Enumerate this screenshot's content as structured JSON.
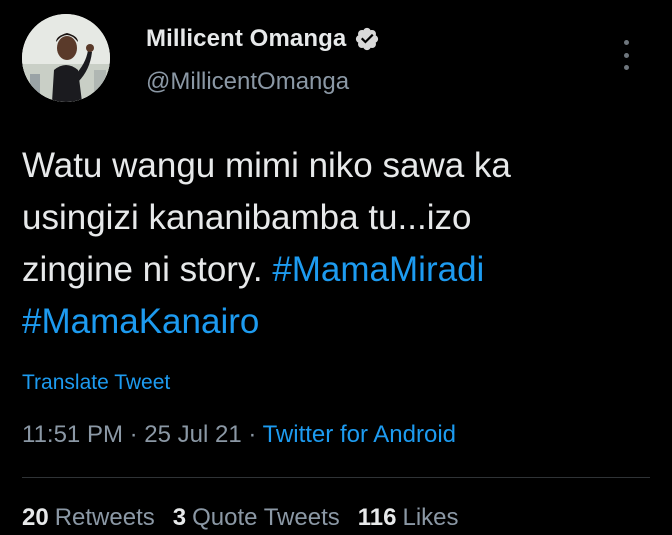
{
  "author": {
    "display_name": "Millicent Omanga",
    "handle": "@MillicentOmanga",
    "verified_icon": "verified-badge-icon",
    "avatar_icon": "profile-photo"
  },
  "tweet": {
    "text_line1": "Watu wangu mimi niko sawa ka",
    "text_line2": "usingizi kananibamba tu...izo",
    "text_line3_plain": "zingine ni story. ",
    "hashtag_1": "#MamaMiradi",
    "hashtag_2": "#MamaKanairo",
    "translate_label": "Translate Tweet"
  },
  "meta": {
    "time": "11:51 PM",
    "separator_1": " · ",
    "date": "25 Jul 21",
    "separator_2": " · ",
    "source": "Twitter for Android"
  },
  "stats": {
    "retweets_count": "20",
    "retweets_label": "Retweets",
    "quotes_count": "3",
    "quotes_label": "Quote Tweets",
    "likes_count": "116",
    "likes_label": "Likes"
  },
  "colors": {
    "background": "#000000",
    "text_primary": "#e7e9ea",
    "text_secondary": "#8b98a5",
    "accent": "#1d9bf0",
    "divider": "#2f3336"
  },
  "icons": {
    "more": "more-options-icon"
  }
}
